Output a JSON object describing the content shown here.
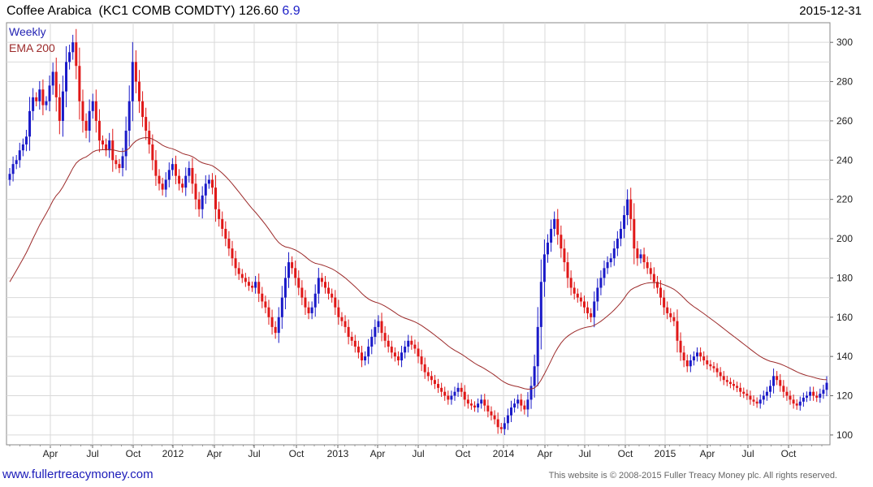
{
  "header": {
    "title": "Coffee Arabica  (KC1 COMB COMDTY) 126.60",
    "change": "6.9",
    "date": "2015-12-31"
  },
  "legend": {
    "weekly": "Weekly",
    "ema": "EMA 200"
  },
  "footer": {
    "site": "www.fullertreacymoney.com",
    "copyright": "This website is © 2008-2015 Fuller Treacy Money plc. All rights reserved."
  },
  "colors": {
    "up": "#1a1ac8",
    "down": "#e01818",
    "ema": "#9c2a2a",
    "grid": "#d9d9d9"
  },
  "chart_data": {
    "type": "candlestick",
    "frequency": "weekly",
    "ylim": [
      95,
      310
    ],
    "y_ticks": [
      100,
      120,
      140,
      160,
      180,
      200,
      220,
      240,
      260,
      280,
      300
    ],
    "x_ticks": [
      "Apr",
      "Jul",
      "Oct",
      "2012",
      "Apr",
      "Jul",
      "Oct",
      "2013",
      "Apr",
      "Jul",
      "Oct",
      "2014",
      "Apr",
      "Jul",
      "Oct",
      "2015",
      "Apr",
      "Jul",
      "Oct"
    ],
    "last_close": 126.6,
    "change": 6.9,
    "series": [
      {
        "name": "Weekly",
        "close": [
          233,
          238,
          240,
          245,
          248,
          252,
          265,
          272,
          270,
          276,
          268,
          270,
          278,
          285,
          272,
          260,
          275,
          290,
          295,
          300,
          288,
          270,
          260,
          255,
          265,
          270,
          260,
          250,
          248,
          245,
          250,
          240,
          238,
          236,
          242,
          255,
          270,
          290,
          280,
          270,
          262,
          255,
          248,
          240,
          232,
          228,
          225,
          230,
          235,
          238,
          232,
          228,
          226,
          232,
          236,
          228,
          220,
          215,
          222,
          228,
          230,
          226,
          215,
          210,
          205,
          200,
          195,
          190,
          185,
          182,
          180,
          178,
          176,
          175,
          178,
          172,
          168,
          165,
          160,
          155,
          152,
          160,
          170,
          180,
          188,
          185,
          180,
          175,
          170,
          165,
          162,
          165,
          172,
          180,
          178,
          175,
          172,
          170,
          165,
          160,
          158,
          155,
          150,
          148,
          145,
          142,
          138,
          140,
          145,
          150,
          155,
          158,
          152,
          148,
          145,
          142,
          140,
          138,
          142,
          145,
          148,
          146,
          144,
          140,
          136,
          132,
          130,
          128,
          126,
          124,
          122,
          120,
          118,
          120,
          122,
          124,
          122,
          118,
          116,
          115,
          114,
          116,
          118,
          115,
          112,
          110,
          108,
          104,
          103,
          106,
          110,
          114,
          116,
          118,
          115,
          113,
          118,
          125,
          135,
          155,
          178,
          192,
          198,
          205,
          210,
          202,
          195,
          188,
          180,
          175,
          172,
          170,
          168,
          165,
          162,
          160,
          168,
          175,
          180,
          185,
          188,
          190,
          195,
          200,
          205,
          212,
          220,
          210,
          195,
          190,
          192,
          188,
          185,
          182,
          178,
          175,
          170,
          165,
          162,
          160,
          158,
          148,
          142,
          138,
          135,
          138,
          140,
          142,
          140,
          138,
          136,
          135,
          134,
          132,
          130,
          128,
          127,
          126,
          125,
          124,
          122,
          121,
          120,
          118,
          117,
          116,
          118,
          120,
          122,
          125,
          130,
          128,
          125,
          122,
          120,
          118,
          116,
          115,
          117,
          119,
          120,
          122,
          120,
          119,
          121,
          123,
          126.6
        ]
      },
      {
        "name": "EMA 200",
        "close": []
      }
    ]
  }
}
